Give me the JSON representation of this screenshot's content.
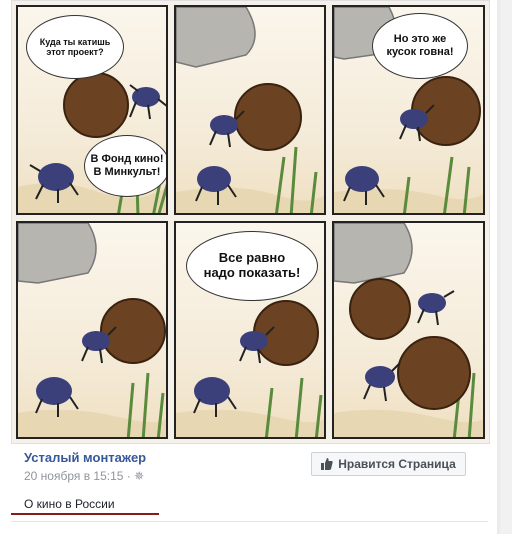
{
  "comic": {
    "bubble1": "Куда ты катишь\nэтот проект?",
    "bubble2": "В Фонд кино!\nВ Минкульт!",
    "bubble3": "Но это же\nкусок говна!",
    "bubble4": "Все равно\nнадо показать!"
  },
  "post": {
    "author": "Усталый монтажер",
    "date": "20 ноября в 15:15 · ",
    "privacy_icon": "gear-icon",
    "like_button": "Нравится Страница",
    "like_icon": "thumbs-up-icon",
    "caption": "О кино в России"
  },
  "colors": {
    "link": "#365899",
    "accent_underline": "#8b1a1a",
    "beetle": "#3b3f7a",
    "ball": "#6b4322"
  }
}
